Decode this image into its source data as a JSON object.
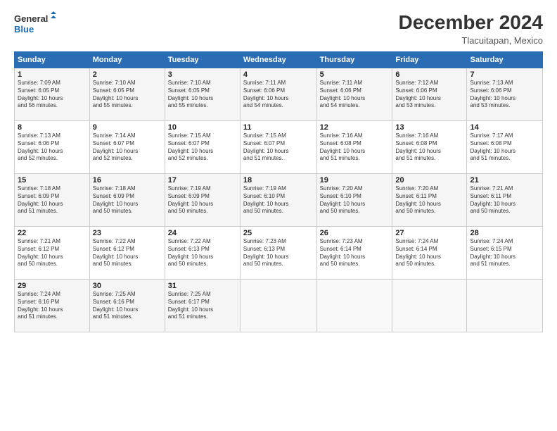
{
  "logo": {
    "line1": "General",
    "line2": "Blue"
  },
  "title": "December 2024",
  "location": "Tlacuitapan, Mexico",
  "days_header": [
    "Sunday",
    "Monday",
    "Tuesday",
    "Wednesday",
    "Thursday",
    "Friday",
    "Saturday"
  ],
  "weeks": [
    [
      {
        "day": "1",
        "info": "Sunrise: 7:09 AM\nSunset: 6:05 PM\nDaylight: 10 hours\nand 56 minutes."
      },
      {
        "day": "2",
        "info": "Sunrise: 7:10 AM\nSunset: 6:05 PM\nDaylight: 10 hours\nand 55 minutes."
      },
      {
        "day": "3",
        "info": "Sunrise: 7:10 AM\nSunset: 6:05 PM\nDaylight: 10 hours\nand 55 minutes."
      },
      {
        "day": "4",
        "info": "Sunrise: 7:11 AM\nSunset: 6:06 PM\nDaylight: 10 hours\nand 54 minutes."
      },
      {
        "day": "5",
        "info": "Sunrise: 7:11 AM\nSunset: 6:06 PM\nDaylight: 10 hours\nand 54 minutes."
      },
      {
        "day": "6",
        "info": "Sunrise: 7:12 AM\nSunset: 6:06 PM\nDaylight: 10 hours\nand 53 minutes."
      },
      {
        "day": "7",
        "info": "Sunrise: 7:13 AM\nSunset: 6:06 PM\nDaylight: 10 hours\nand 53 minutes."
      }
    ],
    [
      {
        "day": "8",
        "info": "Sunrise: 7:13 AM\nSunset: 6:06 PM\nDaylight: 10 hours\nand 52 minutes."
      },
      {
        "day": "9",
        "info": "Sunrise: 7:14 AM\nSunset: 6:07 PM\nDaylight: 10 hours\nand 52 minutes."
      },
      {
        "day": "10",
        "info": "Sunrise: 7:15 AM\nSunset: 6:07 PM\nDaylight: 10 hours\nand 52 minutes."
      },
      {
        "day": "11",
        "info": "Sunrise: 7:15 AM\nSunset: 6:07 PM\nDaylight: 10 hours\nand 51 minutes."
      },
      {
        "day": "12",
        "info": "Sunrise: 7:16 AM\nSunset: 6:08 PM\nDaylight: 10 hours\nand 51 minutes."
      },
      {
        "day": "13",
        "info": "Sunrise: 7:16 AM\nSunset: 6:08 PM\nDaylight: 10 hours\nand 51 minutes."
      },
      {
        "day": "14",
        "info": "Sunrise: 7:17 AM\nSunset: 6:08 PM\nDaylight: 10 hours\nand 51 minutes."
      }
    ],
    [
      {
        "day": "15",
        "info": "Sunrise: 7:18 AM\nSunset: 6:09 PM\nDaylight: 10 hours\nand 51 minutes."
      },
      {
        "day": "16",
        "info": "Sunrise: 7:18 AM\nSunset: 6:09 PM\nDaylight: 10 hours\nand 50 minutes."
      },
      {
        "day": "17",
        "info": "Sunrise: 7:19 AM\nSunset: 6:09 PM\nDaylight: 10 hours\nand 50 minutes."
      },
      {
        "day": "18",
        "info": "Sunrise: 7:19 AM\nSunset: 6:10 PM\nDaylight: 10 hours\nand 50 minutes."
      },
      {
        "day": "19",
        "info": "Sunrise: 7:20 AM\nSunset: 6:10 PM\nDaylight: 10 hours\nand 50 minutes."
      },
      {
        "day": "20",
        "info": "Sunrise: 7:20 AM\nSunset: 6:11 PM\nDaylight: 10 hours\nand 50 minutes."
      },
      {
        "day": "21",
        "info": "Sunrise: 7:21 AM\nSunset: 6:11 PM\nDaylight: 10 hours\nand 50 minutes."
      }
    ],
    [
      {
        "day": "22",
        "info": "Sunrise: 7:21 AM\nSunset: 6:12 PM\nDaylight: 10 hours\nand 50 minutes."
      },
      {
        "day": "23",
        "info": "Sunrise: 7:22 AM\nSunset: 6:12 PM\nDaylight: 10 hours\nand 50 minutes."
      },
      {
        "day": "24",
        "info": "Sunrise: 7:22 AM\nSunset: 6:13 PM\nDaylight: 10 hours\nand 50 minutes."
      },
      {
        "day": "25",
        "info": "Sunrise: 7:23 AM\nSunset: 6:13 PM\nDaylight: 10 hours\nand 50 minutes."
      },
      {
        "day": "26",
        "info": "Sunrise: 7:23 AM\nSunset: 6:14 PM\nDaylight: 10 hours\nand 50 minutes."
      },
      {
        "day": "27",
        "info": "Sunrise: 7:24 AM\nSunset: 6:14 PM\nDaylight: 10 hours\nand 50 minutes."
      },
      {
        "day": "28",
        "info": "Sunrise: 7:24 AM\nSunset: 6:15 PM\nDaylight: 10 hours\nand 51 minutes."
      }
    ],
    [
      {
        "day": "29",
        "info": "Sunrise: 7:24 AM\nSunset: 6:16 PM\nDaylight: 10 hours\nand 51 minutes."
      },
      {
        "day": "30",
        "info": "Sunrise: 7:25 AM\nSunset: 6:16 PM\nDaylight: 10 hours\nand 51 minutes."
      },
      {
        "day": "31",
        "info": "Sunrise: 7:25 AM\nSunset: 6:17 PM\nDaylight: 10 hours\nand 51 minutes."
      },
      {
        "day": "",
        "info": ""
      },
      {
        "day": "",
        "info": ""
      },
      {
        "day": "",
        "info": ""
      },
      {
        "day": "",
        "info": ""
      }
    ]
  ]
}
